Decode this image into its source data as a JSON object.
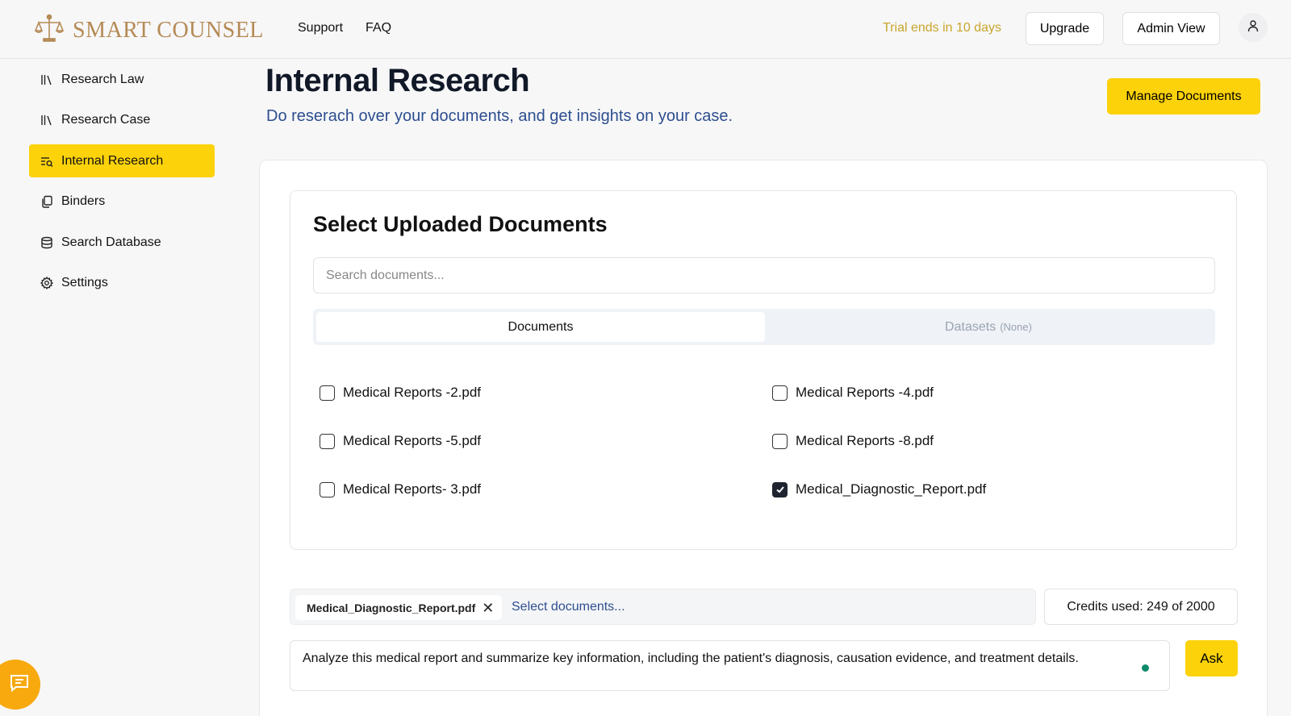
{
  "header": {
    "brand": "SMART COUNSEL",
    "nav": [
      "Support",
      "FAQ"
    ],
    "trial_text": "Trial ends in 10 days",
    "upgrade_label": "Upgrade",
    "admin_view_label": "Admin View"
  },
  "sidebar": {
    "items": [
      {
        "label": "Research Law",
        "icon": "library-icon"
      },
      {
        "label": "Research Case",
        "icon": "library-icon"
      },
      {
        "label": "Internal Research",
        "icon": "list-search-icon",
        "active": true
      },
      {
        "label": "Binders",
        "icon": "copy-icon"
      },
      {
        "label": "Search Database",
        "icon": "database-icon"
      },
      {
        "label": "Settings",
        "icon": "gear-icon"
      }
    ]
  },
  "page": {
    "title": "Internal Research",
    "subtitle": "Do reserach over your documents, and get insights on your case.",
    "manage_label": "Manage Documents"
  },
  "card": {
    "title": "Select Uploaded Documents",
    "search_placeholder": "Search documents...",
    "tabs": {
      "documents": "Documents",
      "datasets": "Datasets",
      "datasets_count": "(None)"
    },
    "documents": [
      {
        "name": "Medical Reports -2.pdf",
        "checked": false
      },
      {
        "name": "Medical Reports -4.pdf",
        "checked": false
      },
      {
        "name": "Medical Reports -5.pdf",
        "checked": false
      },
      {
        "name": "Medical Reports -8.pdf",
        "checked": false
      },
      {
        "name": "Medical Reports- 3.pdf",
        "checked": false
      },
      {
        "name": "Medical_Diagnostic_Report.pdf",
        "checked": true
      }
    ]
  },
  "bottom": {
    "chip_label": "Medical_Diagnostic_Report.pdf",
    "select_placeholder": "Select documents...",
    "credits": "Credits used: 249 of 2000",
    "query": "Analyze this medical report and summarize key information, including the patient's diagnosis, causation evidence, and treatment details.",
    "ask_label": "Ask"
  },
  "colors": {
    "accent": "#fcd20a",
    "brand": "#b58a55",
    "trial": "#c9a52c",
    "link": "#2d4e8f",
    "fab": "#f7a90e"
  }
}
